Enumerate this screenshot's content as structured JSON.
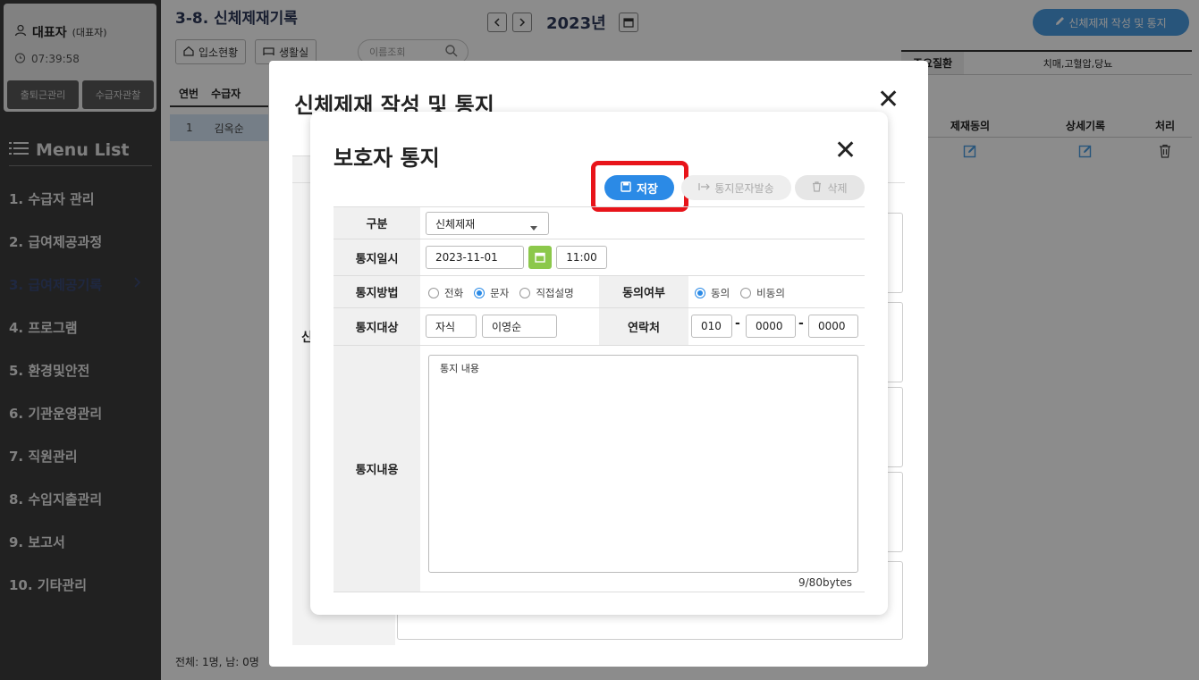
{
  "sidebar": {
    "user_name": "대표자",
    "user_role": "(대표자)",
    "time": "07:39:58",
    "btn_attendance": "출퇴근관리",
    "btn_recipient_obs": "수급자관찰",
    "menu_title": "Menu List",
    "items": [
      {
        "label": "1. 수급자 관리"
      },
      {
        "label": "2. 급여제공과정"
      },
      {
        "label": "3. 급여제공기록"
      },
      {
        "label": "4. 프로그램"
      },
      {
        "label": "5. 환경및안전"
      },
      {
        "label": "6. 기관운영관리"
      },
      {
        "label": "7. 직원관리"
      },
      {
        "label": "8. 수입지출관리"
      },
      {
        "label": "9. 보고서"
      },
      {
        "label": "10. 기타관리"
      }
    ]
  },
  "page": {
    "title": "3-8. 신체제재기록",
    "btn_admission": "입소현황",
    "btn_living_room": "생활실",
    "search_placeholder": "이름조회",
    "list_headers": [
      "연번",
      "수급자"
    ],
    "list_row": {
      "no": "1",
      "name": "김옥순"
    },
    "footer": "전체: 1명, 남: 0명",
    "year": "2023년",
    "create_button": "신체제재 작성 및 통지",
    "info_label": "주요질환",
    "info_value": "치매,고혈압,당뇨",
    "table_headers": [
      "제재동의",
      "상세기록",
      "처리"
    ]
  },
  "outer_modal": {
    "title": "신체제재 작성 및 통지",
    "side_label": "신"
  },
  "modal": {
    "title": "보호자 통지",
    "save_label": "저장",
    "send_label": "통지문자발송",
    "delete_label": "삭제",
    "fields": {
      "category": {
        "label": "구분",
        "value": "신체제재"
      },
      "datetime": {
        "label": "통지일시",
        "date": "2023-11-01",
        "time": "11:00"
      },
      "method": {
        "label": "통지방법",
        "options": [
          "전화",
          "문자",
          "직접설명"
        ],
        "selected": "문자"
      },
      "consent": {
        "label": "동의여부",
        "options": [
          "동의",
          "비동의"
        ],
        "selected": "동의"
      },
      "target": {
        "label": "통지대상",
        "relation": "자식",
        "name": "이영순"
      },
      "contact": {
        "label": "연락처",
        "p1": "010",
        "p2": "0000",
        "p3": "0000"
      },
      "content": {
        "label": "통지내용",
        "value": "통지 내용",
        "bytes": "9/80bytes"
      }
    }
  },
  "colors": {
    "sidebar_bg": "#3d3d3d",
    "accent_blue": "#2b8ae6",
    "highlight_red": "#e8141a",
    "calendar_green": "#8cc84b"
  }
}
